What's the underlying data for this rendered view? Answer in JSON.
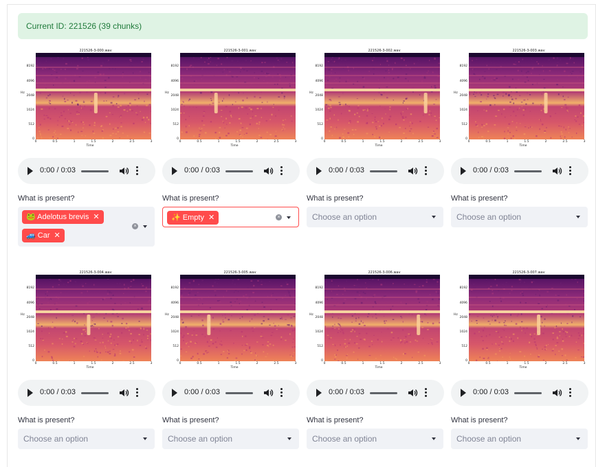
{
  "status": {
    "text": "Current ID: 221526 (39 chunks)"
  },
  "spectrogram": {
    "y_ticks": [
      "8192",
      "4096",
      "2048",
      "1024",
      "512",
      "0"
    ],
    "y_label": "Hz",
    "x_ticks": [
      "0",
      "0.5",
      "1",
      "1.5",
      "2",
      "2.5",
      "3"
    ],
    "x_label": "Time"
  },
  "question_label": "What is present?",
  "select_placeholder": "Choose an option",
  "cells": [
    {
      "file": "221526-3-000.wav",
      "time": "0:00 / 0:03",
      "progress": 0.0,
      "tags": [
        {
          "icon": "🐸",
          "label": "Adelotus brevis"
        },
        {
          "icon": "🚙",
          "label": "Car"
        }
      ]
    },
    {
      "file": "221526-3-001.wav",
      "time": "0:00 / 0:03",
      "progress": 0.0,
      "tags": [
        {
          "icon": "✨",
          "label": "Empty"
        }
      ]
    },
    {
      "file": "221526-3-002.wav",
      "time": "0:00 / 0:03",
      "progress": 0.0,
      "tags": []
    },
    {
      "file": "221526-3-003.wav",
      "time": "0:00 / 0:03",
      "progress": 0.0,
      "tags": []
    },
    {
      "file": "221526-3-004.wav",
      "time": "0:00 / 0:03",
      "progress": 0.0,
      "tags": []
    },
    {
      "file": "221526-3-005.wav",
      "time": "0:00 / 0:03",
      "progress": 0.0,
      "tags": []
    },
    {
      "file": "221526-3-006.wav",
      "time": "0:00 / 0:03",
      "progress": 0.0,
      "tags": []
    },
    {
      "file": "221526-3-007.wav",
      "time": "0:00 / 0:03",
      "progress": 0.0,
      "tags": []
    }
  ],
  "icons": {
    "play": "play-icon",
    "volume": "volume-icon",
    "more": "more-vert-icon",
    "caret": "chevron-down-icon",
    "clear": "clear-icon",
    "remove": "close-icon"
  },
  "colors": {
    "accent": "#ff4b4b",
    "success_bg": "#dff3e4",
    "success_text": "#1f7a3a"
  }
}
